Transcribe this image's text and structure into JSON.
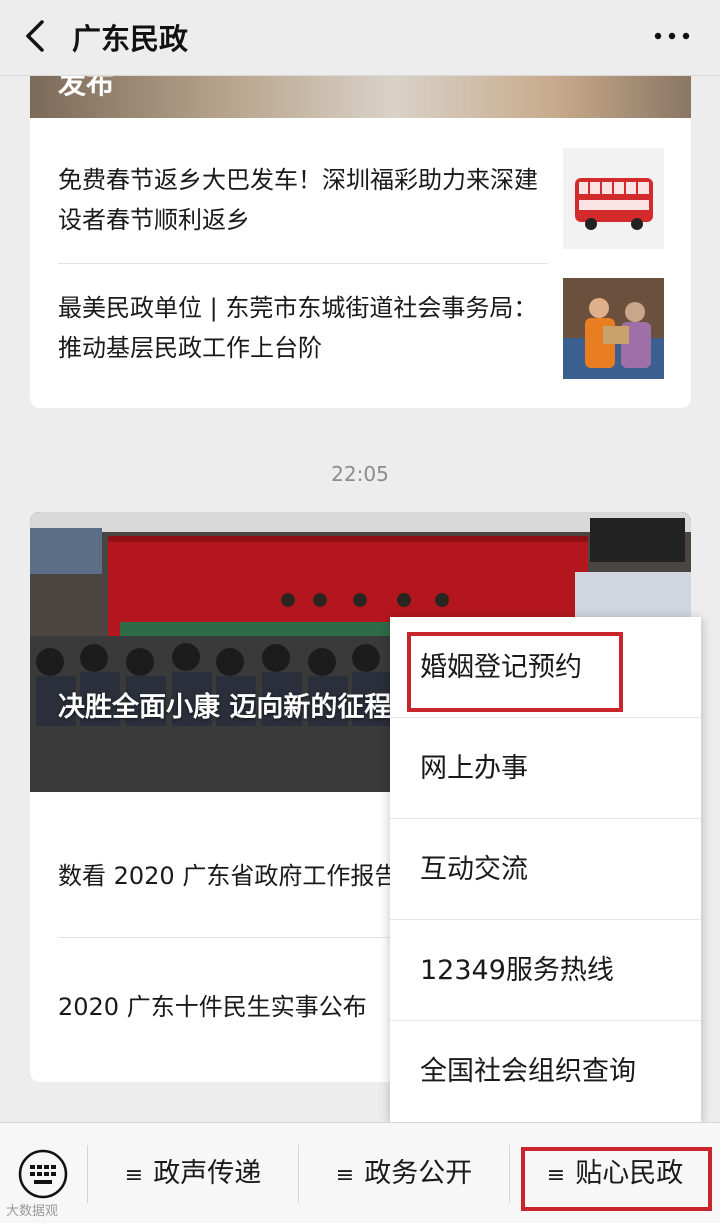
{
  "header": {
    "title": "广东民政",
    "back_icon": "chevron-left-icon",
    "more_icon": "more-dots-icon"
  },
  "card1": {
    "banner_text": "发布",
    "articles": [
      {
        "title": "免费春节返乡大巴发车！深圳福彩助力来深建设者春节顺利返乡",
        "thumb": "red-bus-image"
      },
      {
        "title": "最美民政单位 | 东莞市东城街道社会事务局：推动基层民政工作上台阶",
        "thumb": "volunteer-image"
      }
    ]
  },
  "timestamp": "22:05",
  "card2": {
    "hero_title": "决胜全面小康 迈向新的征程 政工作会议在广州召开",
    "list": [
      {
        "title": "数看 2020 广东省政府工作报告"
      },
      {
        "title": "2020 广东十件民生实事公布"
      }
    ]
  },
  "popup_menu": {
    "items": [
      {
        "label": "婚姻登记预约"
      },
      {
        "label": "网上办事"
      },
      {
        "label": "互动交流"
      },
      {
        "label": "12349服务热线"
      },
      {
        "label": "全国社会组织查询"
      }
    ]
  },
  "bottom_menu": {
    "keyboard_icon": "keyboard-icon",
    "items": [
      {
        "label": "政声传递",
        "glyph": "≡"
      },
      {
        "label": "政务公开",
        "glyph": "≡"
      },
      {
        "label": "贴心民政",
        "glyph": "≡"
      }
    ]
  },
  "watermark": "大数据观",
  "colors": {
    "highlight": "#c8252c",
    "background": "#ededed"
  }
}
